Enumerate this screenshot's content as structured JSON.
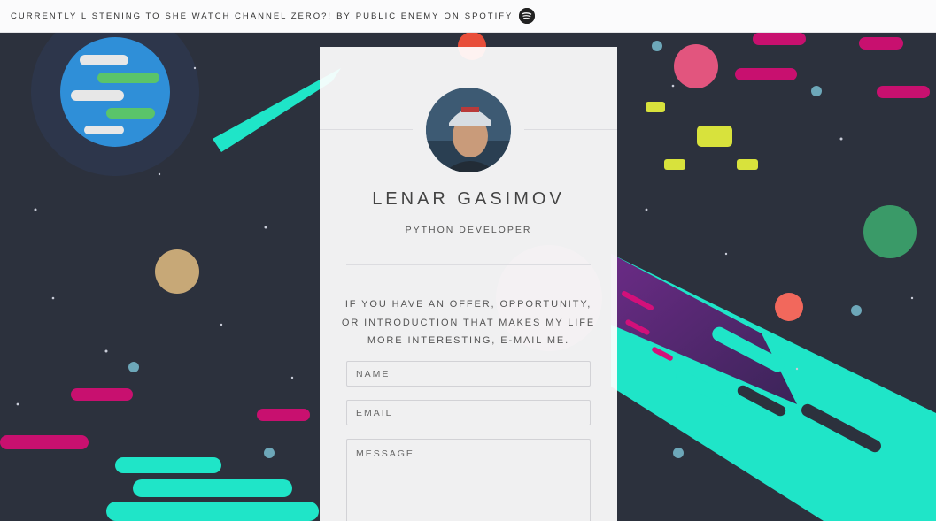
{
  "now_playing": {
    "prefix": "CURRENTLY LISTENING TO",
    "track": "SHE WATCH CHANNEL ZERO?!",
    "by": "BY",
    "artist": "PUBLIC ENEMY",
    "on": "ON",
    "service": "SPOTIFY",
    "icon": "spotify-icon"
  },
  "profile": {
    "name": "LENAR GASIMOV",
    "role": "PYTHON DEVELOPER",
    "avatar": "avatar-photo"
  },
  "contact": {
    "pitch": "IF YOU HAVE AN OFFER, OPPORTUNITY, OR INTRODUCTION THAT MAKES MY LIFE MORE INTERESTING, E-MAIL ME.",
    "name_placeholder": "NAME",
    "email_placeholder": "EMAIL",
    "message_placeholder": "MESSAGE"
  },
  "colors": {
    "background": "#2c313d",
    "card": "#ffffff",
    "comet_cyan": "#1fe5c8",
    "comet_purple": "#5b2a7a",
    "accent_magenta": "#d3107a"
  }
}
